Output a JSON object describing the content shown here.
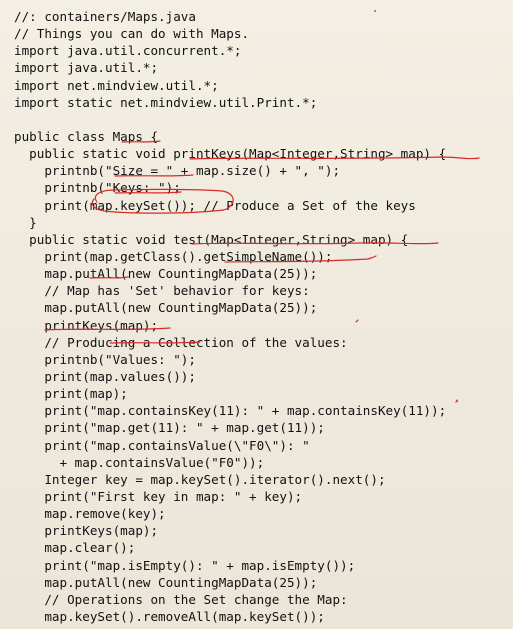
{
  "document": {
    "lines": [
      "//: containers/Maps.java",
      "// Things you can do with Maps.",
      "import java.util.concurrent.*;",
      "import java.util.*;",
      "import net.mindview.util.*;",
      "import static net.mindview.util.Print.*;",
      "",
      "public class Maps {",
      "  public static void printKeys(Map<Integer,String> map) {",
      "    printnb(\"Size = \" + map.size() + \", \");",
      "    printnb(\"Keys: \");",
      "    print(map.keySet()); // Produce a Set of the keys",
      "  }",
      "  public static void test(Map<Integer,String> map) {",
      "    print(map.getClass().getSimpleName());",
      "    map.putAll(new CountingMapData(25));",
      "    // Map has 'Set' behavior for keys:",
      "    map.putAll(new CountingMapData(25));",
      "    printKeys(map);",
      "    // Producing a Collection of the values:",
      "    printnb(\"Values: \");",
      "    print(map.values());",
      "    print(map);",
      "    print(\"map.containsKey(11): \" + map.containsKey(11));",
      "    print(\"map.get(11): \" + map.get(11));",
      "    print(\"map.containsValue(\\\"F0\\\"): \"",
      "      + map.containsValue(\"F0\"));",
      "    Integer key = map.keySet().iterator().next();",
      "    print(\"First key in map: \" + key);",
      "    map.remove(key);",
      "    printKeys(map);",
      "    map.clear();",
      "    print(\"map.isEmpty(): \" + map.isEmpty());",
      "    map.putAll(new CountingMapData(25));",
      "    // Operations on the Set change the Map:",
      "    map.keySet().removeAll(map.keySet());"
    ]
  },
  "colors": {
    "ink": "#111111",
    "paper": "#f1ece1",
    "annotation": "#d62a2a"
  }
}
